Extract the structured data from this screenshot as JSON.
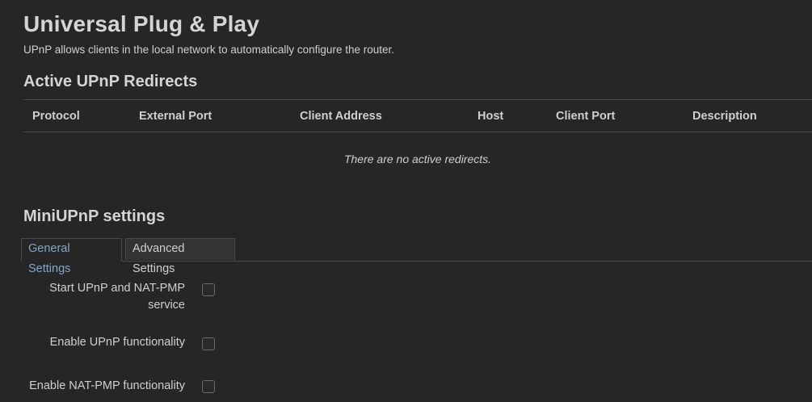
{
  "page": {
    "title": "Universal Plug & Play",
    "description": "UPnP allows clients in the local network to automatically configure the router."
  },
  "redirects": {
    "title": "Active UPnP Redirects",
    "columns": [
      "Protocol",
      "External Port",
      "Client Address",
      "Host",
      "Client Port",
      "Description"
    ],
    "empty_message": "There are no active redirects."
  },
  "settings": {
    "title": "MiniUPnP settings",
    "tabs": [
      {
        "label": "General Settings",
        "active": true
      },
      {
        "label": "Advanced Settings",
        "active": false
      }
    ],
    "options": [
      {
        "label": "Start UPnP and NAT-PMP service",
        "checked": false
      },
      {
        "label": "Enable UPnP functionality",
        "checked": false
      },
      {
        "label": "Enable NAT-PMP functionality",
        "checked": false
      }
    ]
  },
  "colors": {
    "background": "#262626",
    "text": "#cfcfcf",
    "active_tab": "#7fa8c9",
    "border": "#4a4a4a"
  }
}
